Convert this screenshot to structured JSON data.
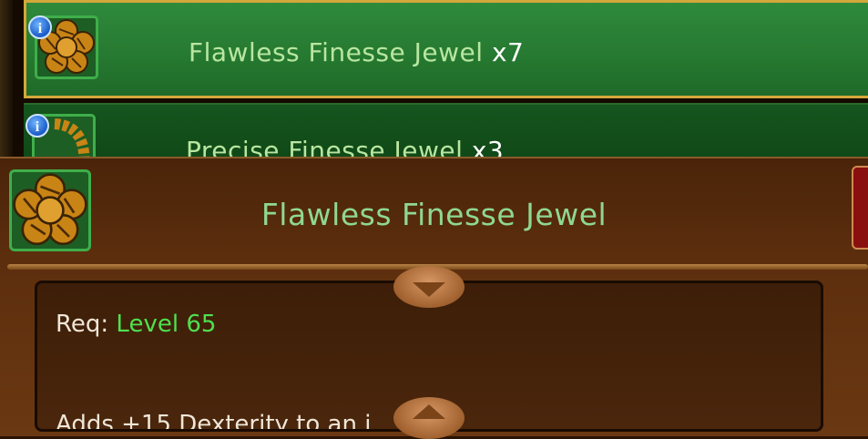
{
  "item_list": [
    {
      "name": "Flawless Finesse Jewel",
      "qty": "x7",
      "icon": "flawless-finesse-jewel-icon",
      "selected": true
    },
    {
      "name": "Precise Finesse Jewel",
      "qty": "x3",
      "icon": "precise-finesse-jewel-icon",
      "selected": false
    }
  ],
  "info_glyph": "i",
  "detail": {
    "title": "Flawless Finesse Jewel",
    "req_label": "Req: ",
    "req_value": "Level 65",
    "effect": "Adds +15 Dexterity to an i"
  },
  "colors": {
    "selected_row": "#2f8a3c",
    "selected_border": "#d4a73a",
    "item_name": "#b9e6a0",
    "title": "#8fd88f",
    "requirement_value": "#4fe04f",
    "panel": "#5e2f0e"
  }
}
